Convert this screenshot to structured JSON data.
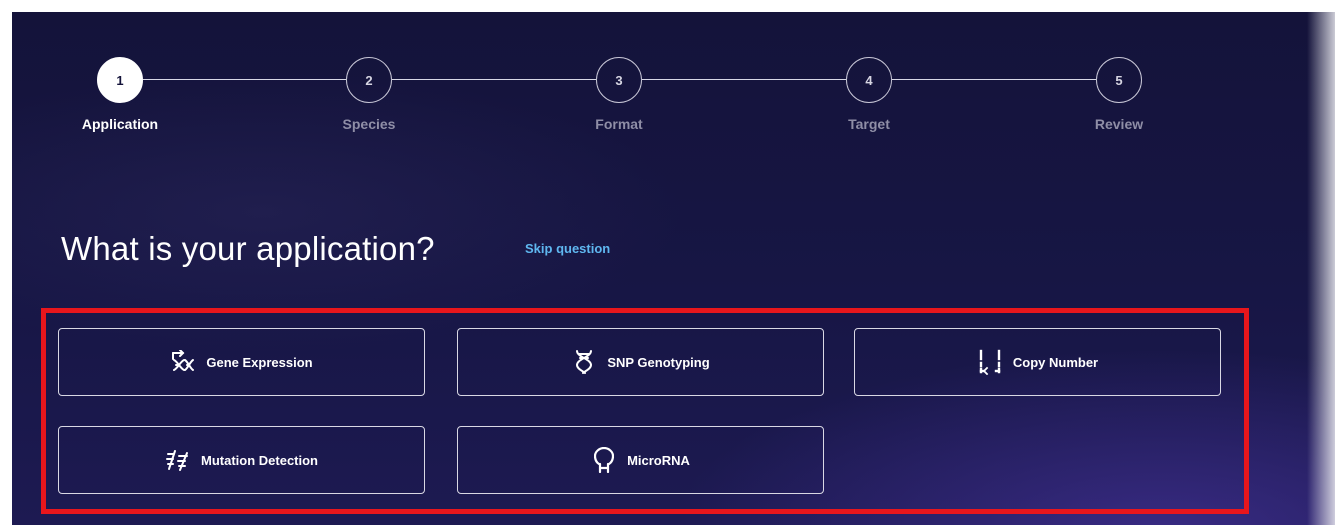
{
  "stepper": {
    "steps": [
      {
        "number": "1",
        "label": "Application",
        "active": true
      },
      {
        "number": "2",
        "label": "Species",
        "active": false
      },
      {
        "number": "3",
        "label": "Format",
        "active": false
      },
      {
        "number": "4",
        "label": "Target",
        "active": false
      },
      {
        "number": "5",
        "label": "Review",
        "active": false
      }
    ]
  },
  "question": {
    "title": "What is your application?",
    "skip_label": "Skip question"
  },
  "options": [
    {
      "label": "Gene Expression",
      "icon": "gene-expression-icon"
    },
    {
      "label": "SNP Genotyping",
      "icon": "dna-helix-icon"
    },
    {
      "label": "Copy Number",
      "icon": "copy-number-icon"
    },
    {
      "label": "Mutation Detection",
      "icon": "mutation-detection-icon"
    },
    {
      "label": "MicroRNA",
      "icon": "microrna-icon"
    }
  ],
  "colors": {
    "background": "#171645",
    "accent_link": "#5fb7f0",
    "highlight_frame": "#e8161c"
  }
}
